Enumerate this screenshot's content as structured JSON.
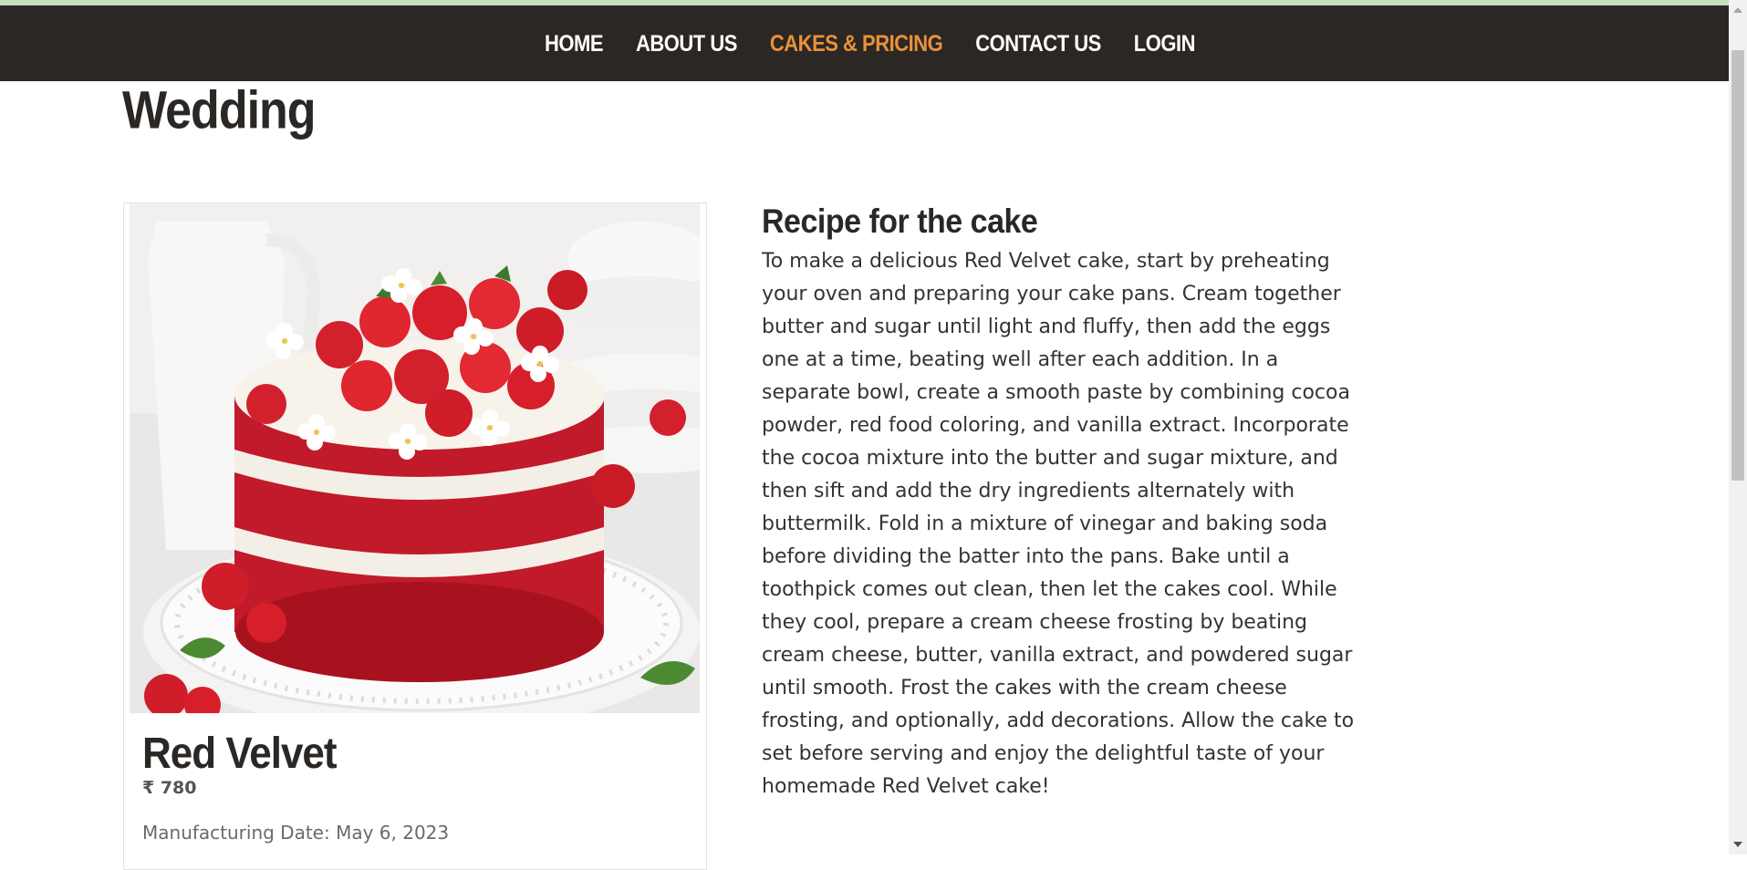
{
  "nav": {
    "items": [
      {
        "label": "HOME"
      },
      {
        "label": "ABOUT US"
      },
      {
        "label": "CAKES & PRICING"
      },
      {
        "label": "CONTACT US"
      },
      {
        "label": "LOGIN"
      }
    ],
    "active_index": 2,
    "active_color": "#e8923a",
    "background": "#2b2724"
  },
  "page": {
    "title": "Wedding"
  },
  "product": {
    "name": "Red Velvet",
    "price": "₹ 780",
    "manufacturing_label": "Manufacturing Date: May 6, 2023"
  },
  "recipe": {
    "title": "Recipe for the cake",
    "body": "To make a delicious Red Velvet cake, start by preheating your oven and preparing your cake pans. Cream together butter and sugar until light and fluffy, then add the eggs one at a time, beating well after each addition. In a separate bowl, create a smooth paste by combining cocoa powder, red food coloring, and vanilla extract. Incorporate the cocoa mixture into the butter and sugar mixture, and then sift and add the dry ingredients alternately with buttermilk. Fold in a mixture of vinegar and baking soda before dividing the batter into the pans. Bake until a toothpick comes out clean, then let the cakes cool. While they cool, prepare a cream cheese frosting by beating cream cheese, butter, vanilla extract, and powdered sugar until smooth. Frost the cakes with the cream cheese frosting, and optionally, add decorations. Allow the cake to set before serving and enjoy the delightful taste of your homemade Red Velvet cake!"
  }
}
